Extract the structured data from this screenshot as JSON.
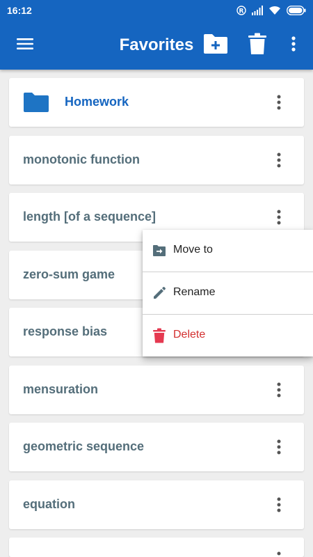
{
  "status_bar": {
    "time": "16:12",
    "icons": [
      "registered-icon",
      "signal-icon",
      "wifi-icon",
      "battery-icon"
    ]
  },
  "app_bar": {
    "title": "Favorites",
    "actions": [
      "menu-icon",
      "new-folder-icon",
      "trash-icon",
      "more-vert-icon"
    ]
  },
  "colors": {
    "primary": "#1565c0",
    "item_text": "#546e7a",
    "folder_text": "#1565c0",
    "delete": "#d32f2f",
    "background": "#eeeeee"
  },
  "items": [
    {
      "label": "Homework",
      "type": "folder"
    },
    {
      "label": "monotonic function",
      "type": "term"
    },
    {
      "label": "length [of a sequence]",
      "type": "term"
    },
    {
      "label": "zero-sum game",
      "type": "term"
    },
    {
      "label": "response bias",
      "type": "term"
    },
    {
      "label": "mensuration",
      "type": "term"
    },
    {
      "label": "geometric sequence",
      "type": "term"
    },
    {
      "label": "equation",
      "type": "term"
    }
  ],
  "context_menu": {
    "items": [
      {
        "label": "Move to",
        "icon": "move-to-icon"
      },
      {
        "label": "Rename",
        "icon": "pencil-icon"
      },
      {
        "label": "Delete",
        "icon": "trash-icon"
      }
    ]
  }
}
